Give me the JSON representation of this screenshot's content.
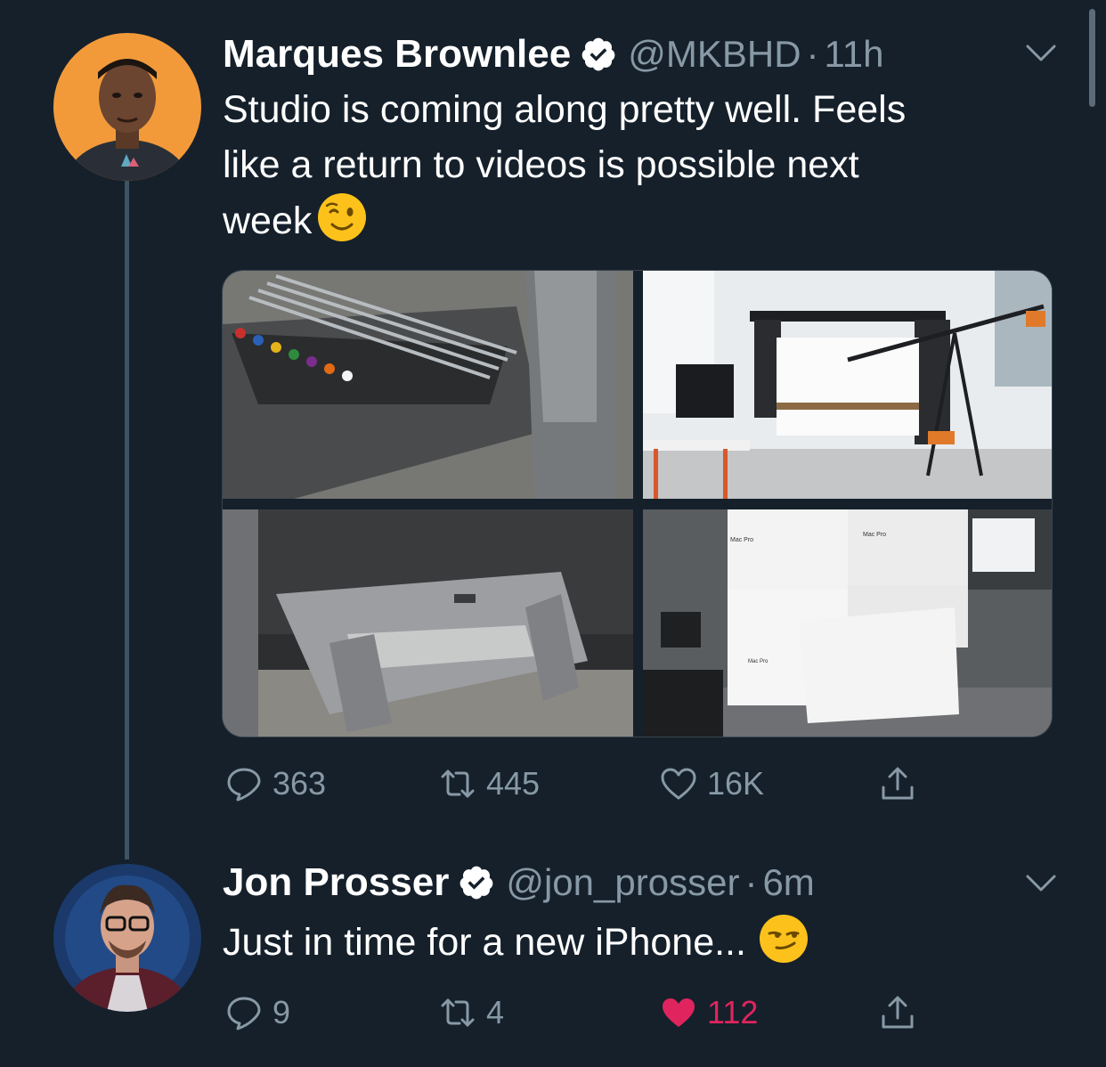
{
  "tweets": [
    {
      "display_name": "Marques Brownlee",
      "verified_icon": "verified-badge",
      "handle": "@MKBHD",
      "separator": "·",
      "time": "11h",
      "text_lines": [
        "Studio is coming along pretty well. Feels",
        "like a return to videos is possible next",
        "week"
      ],
      "emoji": "winking-face",
      "media_count": 4,
      "actions": {
        "reply_count": "363",
        "retweet_count": "445",
        "like_count": "16K",
        "liked": false
      }
    },
    {
      "display_name": "Jon Prosser",
      "verified_icon": "verified-badge",
      "handle": "@jon_prosser",
      "separator": "·",
      "time": "6m",
      "text": "Just in time for a new iPhone...",
      "emoji": "smirking-face",
      "actions": {
        "reply_count": "9",
        "retweet_count": "4",
        "like_count": "112",
        "liked": true
      }
    }
  ],
  "media_labels": {
    "box_label_1": "Mac Pro",
    "box_label_2": "Mac Pro",
    "box_label_3": "Mac Pro"
  },
  "colors": {
    "background": "#15202b",
    "muted_text": "#8899a6",
    "verified_blue": "#ffffff",
    "like_red": "#e0245e",
    "thread_line": "#3d5466"
  }
}
